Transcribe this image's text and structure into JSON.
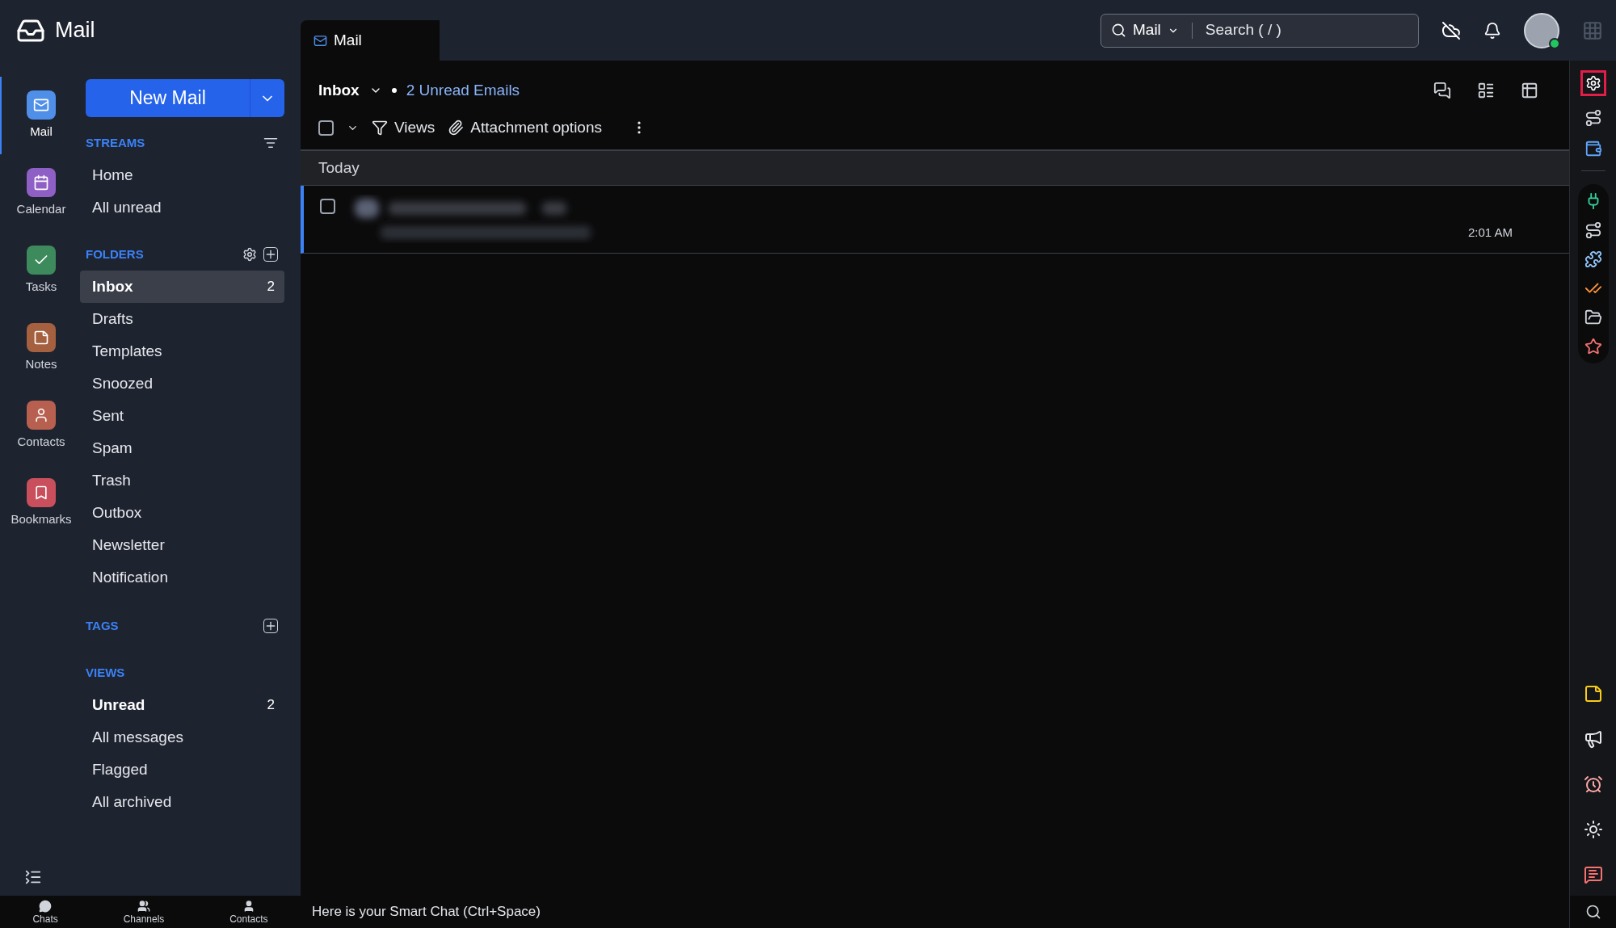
{
  "app": {
    "title": "Mail"
  },
  "rail": [
    {
      "label": "Mail",
      "selected": true,
      "color": "#4f8fe8",
      "kind": "mail"
    },
    {
      "label": "Calendar",
      "selected": false,
      "color": "#8e5fc4",
      "kind": "calendar"
    },
    {
      "label": "Tasks",
      "selected": false,
      "color": "#3d8a5c",
      "kind": "tasks"
    },
    {
      "label": "Notes",
      "selected": false,
      "color": "#a4603f",
      "kind": "notes"
    },
    {
      "label": "Contacts",
      "selected": false,
      "color": "#b8604f",
      "kind": "contacts"
    },
    {
      "label": "Bookmarks",
      "selected": false,
      "color": "#c94f5c",
      "kind": "bookmarks"
    }
  ],
  "new_mail": "New Mail",
  "streams": {
    "title": "STREAMS",
    "items": [
      {
        "label": "Home",
        "selected": false,
        "bold": false
      },
      {
        "label": "All unread",
        "selected": false,
        "bold": false
      }
    ]
  },
  "folders": {
    "title": "FOLDERS",
    "items": [
      {
        "label": "Inbox",
        "count": "2",
        "selected": true,
        "bold": true
      },
      {
        "label": "Drafts",
        "selected": false,
        "bold": false
      },
      {
        "label": "Templates",
        "selected": false,
        "bold": false
      },
      {
        "label": "Snoozed",
        "selected": false,
        "bold": false
      },
      {
        "label": "Sent",
        "selected": false,
        "bold": false
      },
      {
        "label": "Spam",
        "selected": false,
        "bold": false
      },
      {
        "label": "Trash",
        "selected": false,
        "bold": false
      },
      {
        "label": "Outbox",
        "selected": false,
        "bold": false
      },
      {
        "label": "Newsletter",
        "selected": false,
        "bold": false
      },
      {
        "label": "Notification",
        "selected": false,
        "bold": false
      }
    ]
  },
  "tags": {
    "title": "TAGS"
  },
  "views": {
    "title": "VIEWS",
    "items": [
      {
        "label": "Unread",
        "count": "2",
        "selected": false,
        "bold": true
      },
      {
        "label": "All messages",
        "selected": false,
        "bold": false
      },
      {
        "label": "Flagged",
        "selected": false,
        "bold": false
      },
      {
        "label": "All archived",
        "selected": false,
        "bold": false
      }
    ]
  },
  "bottom_nav": [
    "Chats",
    "Channels",
    "Contacts"
  ],
  "tab": "Mail",
  "search": {
    "scope": "Mail",
    "placeholder": "Search ( / )"
  },
  "list_header": {
    "folder": "Inbox",
    "unread": "2 Unread Emails"
  },
  "toolbar": {
    "select_all_checked": false,
    "views": "Views",
    "attachments": "Attachment options"
  },
  "groups": [
    {
      "label": "Today",
      "messages": [
        {
          "time": "2:01 AM",
          "unread": true,
          "checked": false
        }
      ]
    }
  ],
  "smart_chat": "Here is your Smart Chat (Ctrl+Space)"
}
